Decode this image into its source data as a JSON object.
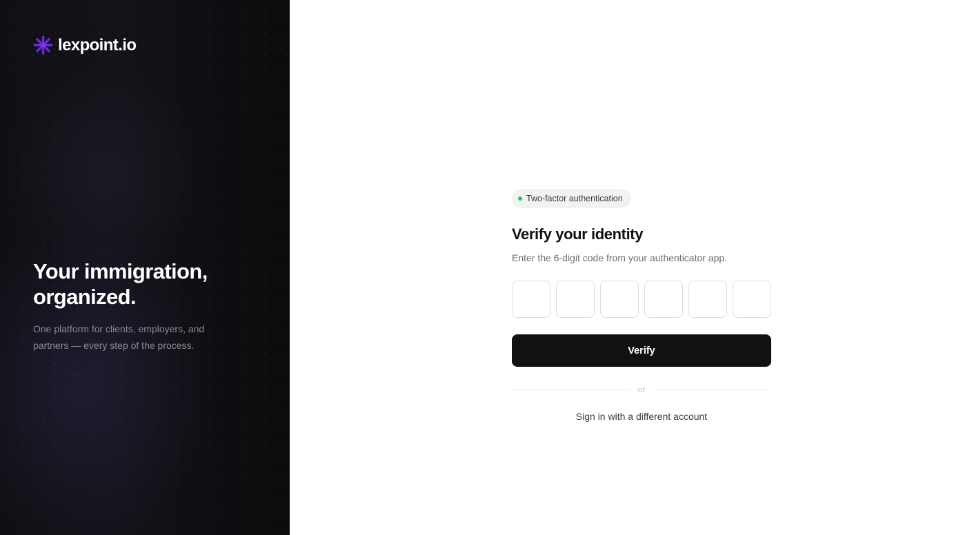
{
  "brand": {
    "logo_text": "lexpoint.io",
    "logo_icon": "asterisk-logo-icon",
    "accent_color": "#6d28d9",
    "headline": "Your immigration, organized.",
    "subheadline": "One platform for clients, employers, and partners — every step of the process."
  },
  "form": {
    "badge_label": "Two-factor authentication",
    "badge_dot_color": "#22c55e",
    "title": "Verify your identity",
    "subtitle": "Enter the 6-digit code from your authenticator app.",
    "code_digits": [
      "",
      "",
      "",
      "",
      "",
      ""
    ],
    "verify_label": "Verify",
    "divider_label": "or",
    "alt_link_label": "Sign in with a different account"
  }
}
